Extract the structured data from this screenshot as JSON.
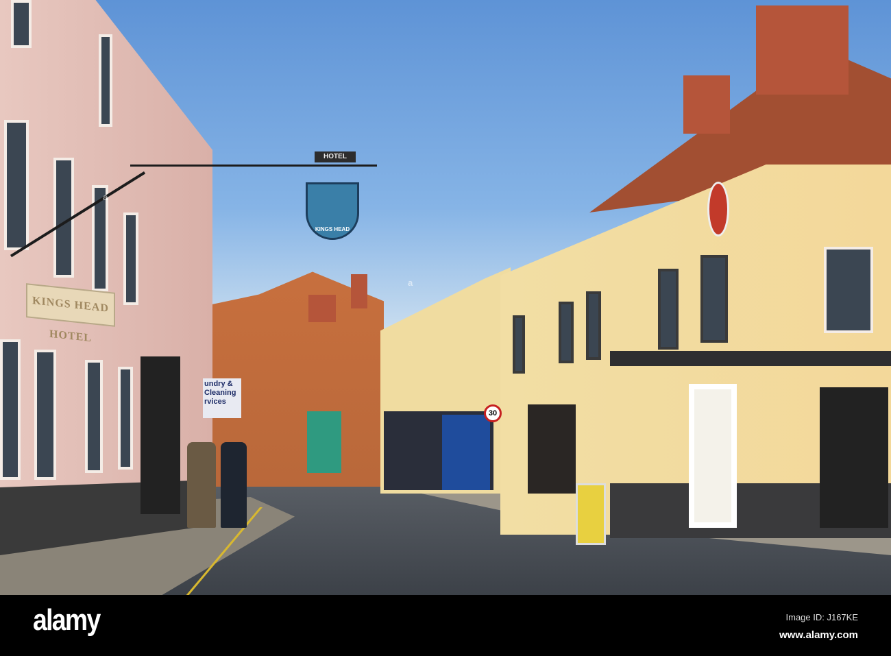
{
  "photo": {
    "signs": {
      "hotel": "HOTEL",
      "kings_head": "KINGS HEAD",
      "facade_lettering": "KINGS HEAD HOTEL",
      "laundry": "undry & Cleaning rvices",
      "speed_limit": "30"
    }
  },
  "footer": {
    "logo": "alamy",
    "image_id": "Image ID: J167KE",
    "url": "www.alamy.com"
  },
  "colors": {
    "sky": "#6fa3dd",
    "footer": "#000000"
  }
}
